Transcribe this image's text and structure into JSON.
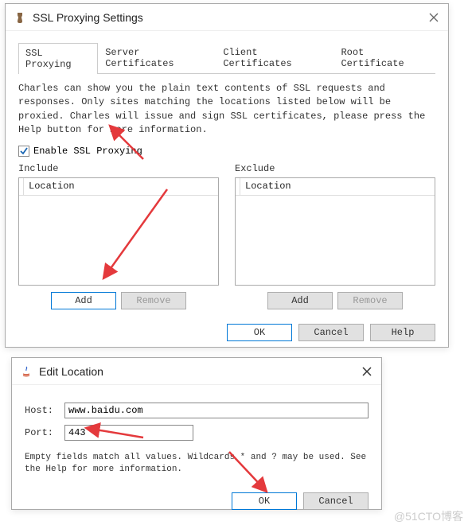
{
  "main_dialog": {
    "title": "SSL Proxying Settings",
    "tabs": [
      "SSL Proxying",
      "Server Certificates",
      "Client Certificates",
      "Root Certificate"
    ],
    "description": "Charles can show you the plain text contents of SSL requests and responses. Only sites matching the locations listed below will be proxied. Charles will issue and sign SSL certificates, please press the Help button for more information.",
    "enable_label": "Enable SSL Proxying",
    "enable_checked": true,
    "include": {
      "title": "Include",
      "header": "Location",
      "add": "Add",
      "remove": "Remove"
    },
    "exclude": {
      "title": "Exclude",
      "header": "Location",
      "add": "Add",
      "remove": "Remove"
    },
    "footer": {
      "ok": "OK",
      "cancel": "Cancel",
      "help": "Help"
    }
  },
  "edit_dialog": {
    "title": "Edit Location",
    "host_label": "Host:",
    "host_value": "www.baidu.com",
    "port_label": "Port:",
    "port_value": "443",
    "hint": "Empty fields match all values. Wildcards * and ? may be used. See the Help for more information.",
    "ok": "OK",
    "cancel": "Cancel"
  },
  "watermark": "@51CTO博客"
}
